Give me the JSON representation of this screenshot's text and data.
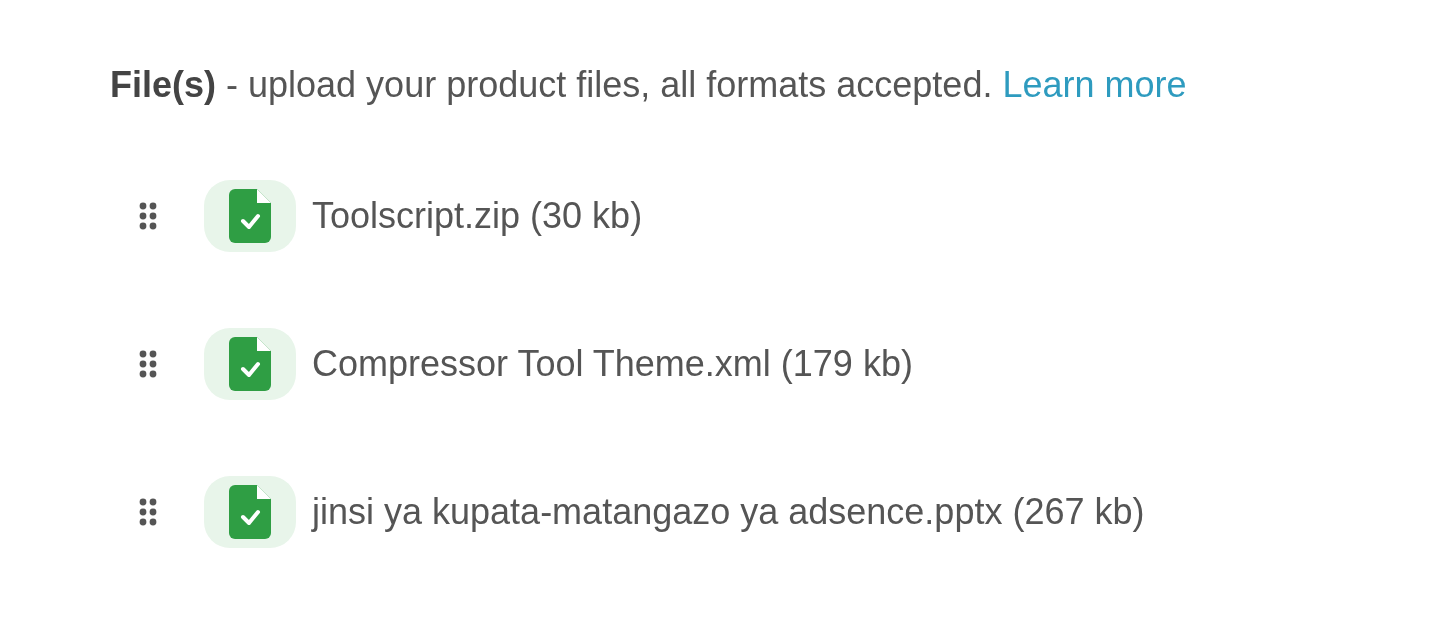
{
  "header": {
    "text": "**File(s)** - upload your product files, all formats accepted.",
    "link": "Learn more"
  },
  "files": [
    {
      "name": "Toolscript.zip (30 kb)"
    },
    {
      "name": "Compressor Tool Theme.xml (179 kb)"
    },
    {
      "name": "jinsi ya kupata-matangazo ya adsence.pptx (267 kb)"
    }
  ]
}
